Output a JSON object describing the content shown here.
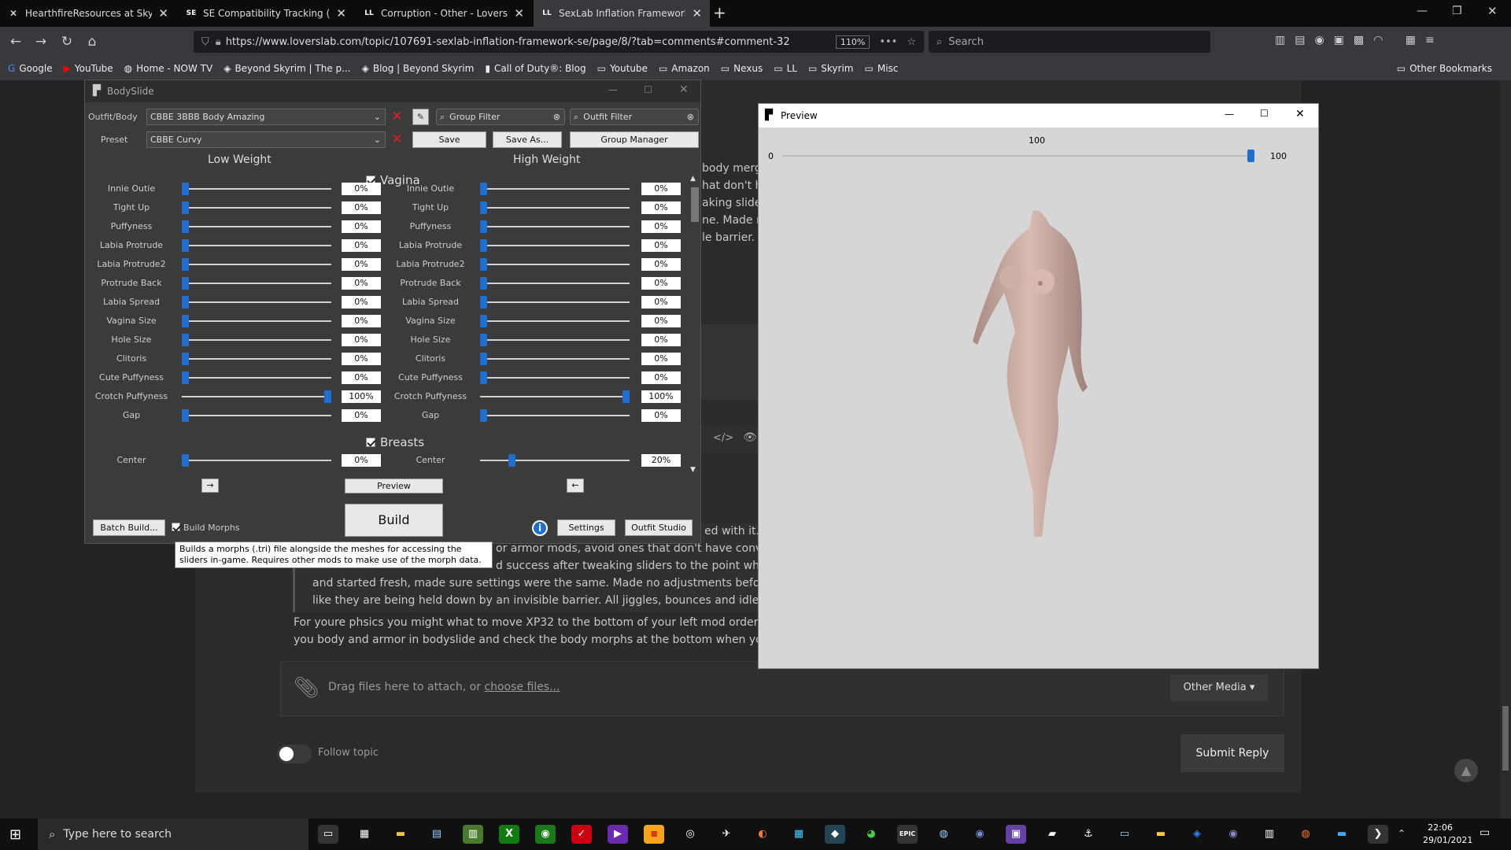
{
  "browser": {
    "tabs": [
      {
        "title": "HearthfireResources at Skyrim",
        "fav": "✕"
      },
      {
        "title": "SE Compatibility Tracking (Jan",
        "fav": "SE"
      },
      {
        "title": "Corruption - Other - LoversLab",
        "fav": "LL"
      },
      {
        "title": "SexLab Inflation Framework SE",
        "fav": "LL"
      }
    ],
    "url": "https://www.loverslab.com/topic/107691-sexlab-inflation-framework-se/page/8/?tab=comments#comment-32",
    "zoom": "110%",
    "search_placeholder": "Search",
    "bookmarks": [
      "Google",
      "YouTube",
      "Home - NOW TV",
      "Beyond Skyrim | The p...",
      "Blog | Beyond Skyrim",
      "Call of Duty®: Blog",
      "Youtube",
      "Amazon",
      "Nexus",
      "LL",
      "Skyrim",
      "Misc"
    ],
    "other_bookmarks": "Other Bookmarks"
  },
  "page": {
    "right_snippets": [
      "body merg",
      "hat don't h",
      "aking slide",
      "ne. Made n",
      "le barrier. A"
    ],
    "quote_lines": [
      "ed with it. I",
      "or armor mods, avoid ones that don't have convers",
      "d success after tweaking sliders to the point where b",
      "and started fresh, made sure settings were the same. Made no adjustments before loa",
      "like they are being held down by an invisible barrier. All jiggles, bounces and idle anim"
    ],
    "reply_lines": [
      "For youre phsics you might what to move XP32 to the bottom of your left mod order (not",
      "you body and armor in bodyslide and check the body morphs at the bottom when you bu"
    ],
    "attach_text": "Drag files here to attach, or ",
    "attach_link": "choose files...",
    "other_media": "Other Media ▾",
    "follow_topic": "Follow topic",
    "submit_reply": "Submit Reply"
  },
  "bodyslide": {
    "title": "BodySlide",
    "outfit_label": "Outfit/Body",
    "outfit_value": "CBBE 3BBB Body Amazing",
    "preset_label": "Preset",
    "preset_value": "CBBE Curvy",
    "group_filter": "Group Filter",
    "outfit_filter": "Outfit Filter",
    "save": "Save",
    "save_as": "Save As...",
    "group_manager": "Group Manager",
    "low_weight": "Low Weight",
    "high_weight": "High Weight",
    "section_vagina": "Vagina",
    "section_breasts": "Breasts",
    "sliders": [
      {
        "name": "Innie Outie",
        "low": "0%",
        "high": "0%",
        "lowpos": 0,
        "highpos": 0
      },
      {
        "name": "Tight Up",
        "low": "0%",
        "high": "0%",
        "lowpos": 0,
        "highpos": 0
      },
      {
        "name": "Puffyness",
        "low": "0%",
        "high": "0%",
        "lowpos": 0,
        "highpos": 0
      },
      {
        "name": "Labia Protrude",
        "low": "0%",
        "high": "0%",
        "lowpos": 0,
        "highpos": 0
      },
      {
        "name": "Labia Protrude2",
        "low": "0%",
        "high": "0%",
        "lowpos": 0,
        "highpos": 0
      },
      {
        "name": "Protrude Back",
        "low": "0%",
        "high": "0%",
        "lowpos": 0,
        "highpos": 0
      },
      {
        "name": "Labia Spread",
        "low": "0%",
        "high": "0%",
        "lowpos": 0,
        "highpos": 0
      },
      {
        "name": "Vagina Size",
        "low": "0%",
        "high": "0%",
        "lowpos": 0,
        "highpos": 0
      },
      {
        "name": "Hole Size",
        "low": "0%",
        "high": "0%",
        "lowpos": 0,
        "highpos": 0
      },
      {
        "name": "Clitoris",
        "low": "0%",
        "high": "0%",
        "lowpos": 0,
        "highpos": 0
      },
      {
        "name": "Cute Puffyness",
        "low": "0%",
        "high": "0%",
        "lowpos": 0,
        "highpos": 0
      },
      {
        "name": "Crotch Puffyness",
        "low": "100%",
        "high": "100%",
        "lowpos": 1,
        "highpos": 1
      },
      {
        "name": "Gap",
        "low": "0%",
        "high": "0%",
        "lowpos": 0,
        "highpos": 0
      }
    ],
    "center": {
      "name": "Center",
      "low": "0%",
      "high": "20%",
      "lowpos": 0,
      "highpos": 0.2
    },
    "arrow_right": "→",
    "arrow_left": "←",
    "preview": "Preview",
    "build": "Build",
    "batch_build": "Batch Build...",
    "build_morphs": "Build Morphs",
    "settings": "Settings",
    "outfit_studio": "Outfit Studio",
    "tooltip": "Builds a morphs (.tri) file alongside the meshes for accessing the sliders in-game. Requires other mods to make use of the morph data."
  },
  "preview": {
    "title": "Preview",
    "weight_label": "100",
    "min": "0",
    "max": "100",
    "weight_level": 1
  },
  "taskbar": {
    "search_placeholder": "Type here to search",
    "time": "22:06",
    "date": "29/01/2021"
  }
}
